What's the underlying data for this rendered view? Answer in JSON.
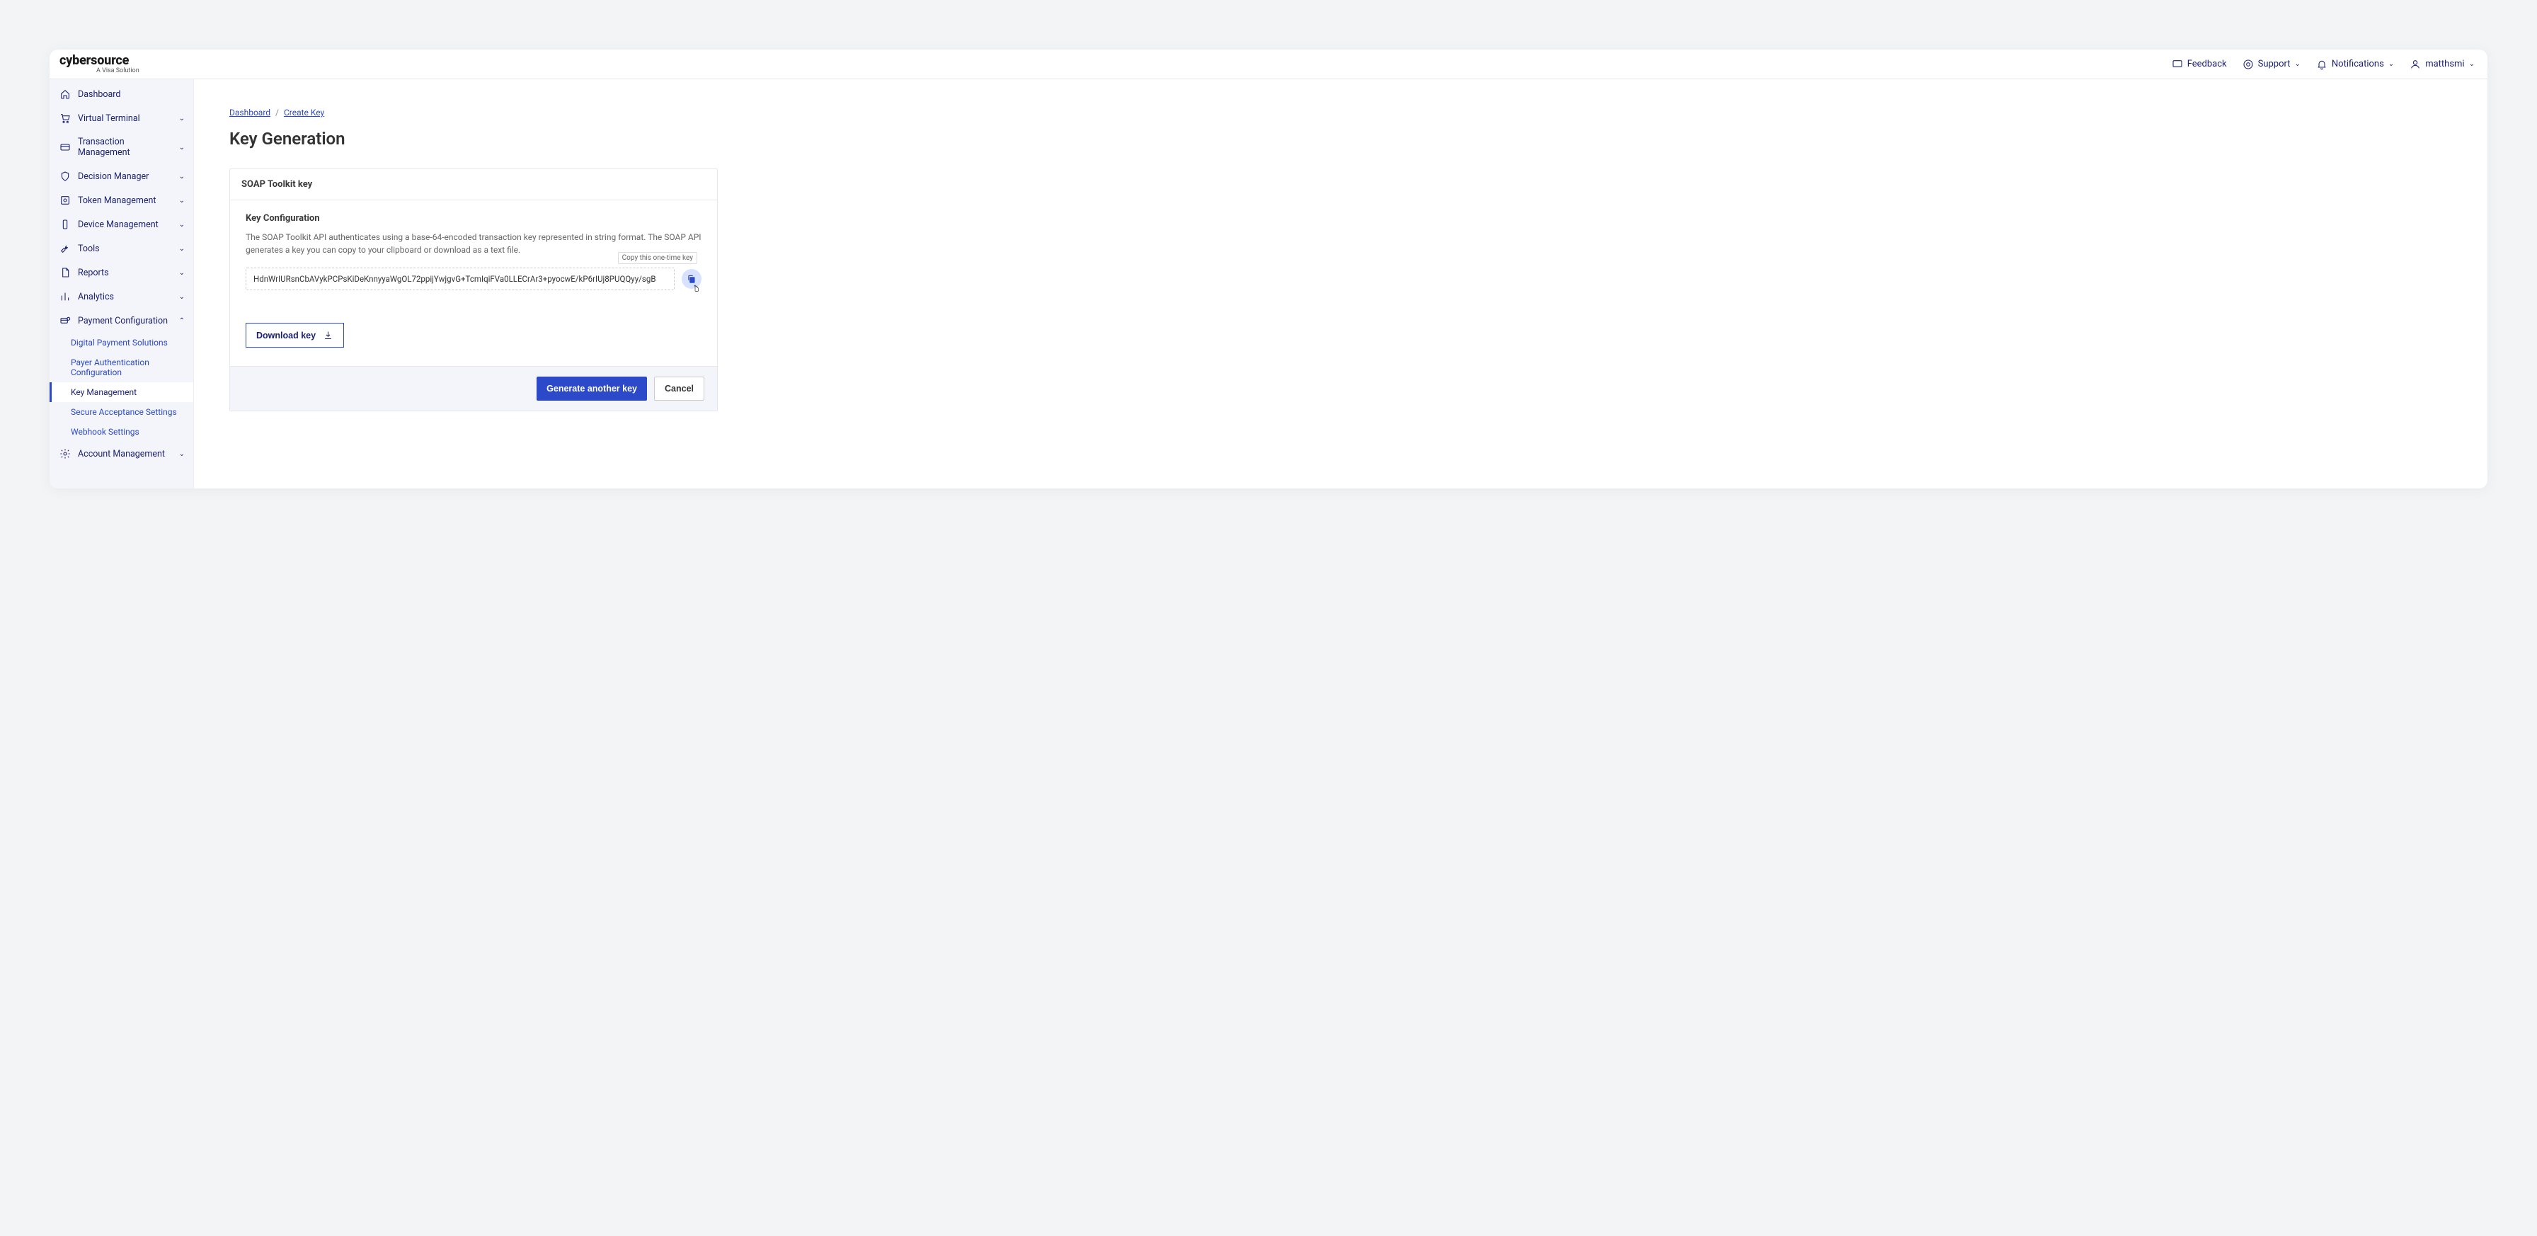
{
  "brand": {
    "main": "cybersource",
    "sub": "A Visa Solution"
  },
  "topbar": {
    "feedback": "Feedback",
    "support": "Support",
    "notifications": "Notifications",
    "user": "matthsmi"
  },
  "sidebar": {
    "items": [
      {
        "label": "Dashboard",
        "icon": "home",
        "chev": false
      },
      {
        "label": "Virtual Terminal",
        "icon": "cart",
        "chev": true
      },
      {
        "label": "Transaction Management",
        "icon": "card",
        "chev": true
      },
      {
        "label": "Decision Manager",
        "icon": "shield",
        "chev": true
      },
      {
        "label": "Token Management",
        "icon": "token",
        "chev": true
      },
      {
        "label": "Device Management",
        "icon": "device",
        "chev": true
      },
      {
        "label": "Tools",
        "icon": "wrench",
        "chev": true
      },
      {
        "label": "Reports",
        "icon": "doc",
        "chev": true
      },
      {
        "label": "Analytics",
        "icon": "bars",
        "chev": true
      },
      {
        "label": "Payment Configuration",
        "icon": "payconf",
        "chev": true,
        "expanded": true,
        "subs": [
          {
            "label": "Digital Payment Solutions"
          },
          {
            "label": "Payer Authentication Configuration"
          },
          {
            "label": "Key Management",
            "active": true
          },
          {
            "label": "Secure Acceptance Settings"
          },
          {
            "label": "Webhook Settings"
          }
        ]
      },
      {
        "label": "Account Management",
        "icon": "gear",
        "chev": true
      }
    ]
  },
  "breadcrumb": {
    "a": "Dashboard",
    "b": "Create Key"
  },
  "page_title": "Key Generation",
  "card": {
    "header": "SOAP Toolkit key",
    "section_title": "Key Configuration",
    "desc": "The SOAP Toolkit API authenticates using a base-64-encoded transaction key represented in string format. The SOAP API generates a key you can copy to your clipboard or download as a text file.",
    "tooltip": "Copy this one-time key",
    "key_value": "HdnWrIURsnCbAVykPCPsKiDeKnnyyaWgOL72ppijYwjgvG+TcmIqiFVa0LLECrAr3+pyocwE/kP6rIUj8PUQQyy/sgB",
    "download_label": "Download key",
    "generate_label": "Generate another key",
    "cancel_label": "Cancel"
  }
}
